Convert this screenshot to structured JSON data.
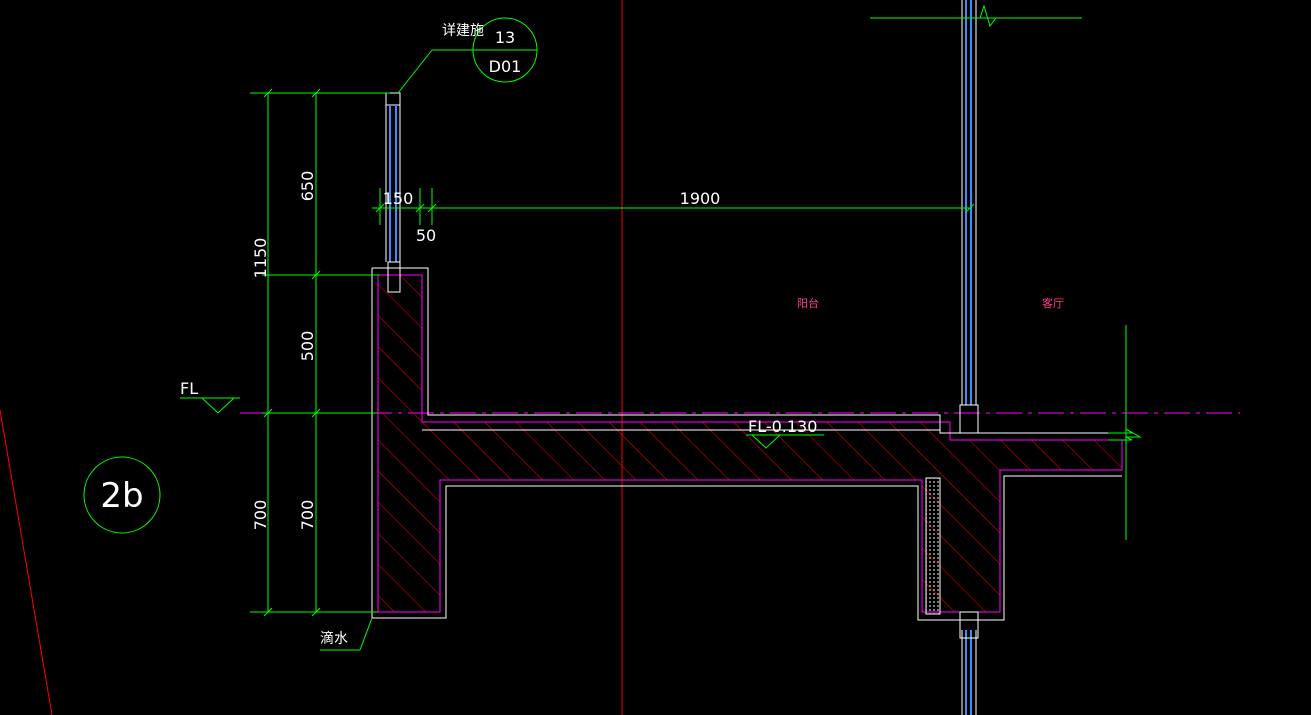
{
  "drawing": {
    "detail_reference": {
      "label": "详建施",
      "number": "13",
      "sheet": "D01"
    },
    "section_marker": "2b",
    "dimensions": {
      "total_height": "1150",
      "upper_height": "650",
      "mid_height": "500",
      "lower_height_outer": "700",
      "lower_height_inner": "700",
      "wall_thickness": "150",
      "gap": "50",
      "balcony_depth": "1900"
    },
    "level_marks": {
      "floor": "FL",
      "balcony_floor": "FL-0.130"
    },
    "room_labels": {
      "balcony": "阳台",
      "living_room": "客厅"
    },
    "note_drip": "滴水"
  },
  "colors": {
    "background": "#000000",
    "dimension": "#00ff00",
    "structure_outline": "#ffffff",
    "hatch": "#ff0000",
    "magenta": "#ff00ff",
    "axis_red": "#ff0000",
    "glass_blue": "#3a8cff",
    "room_label": "#ff3c8c"
  }
}
